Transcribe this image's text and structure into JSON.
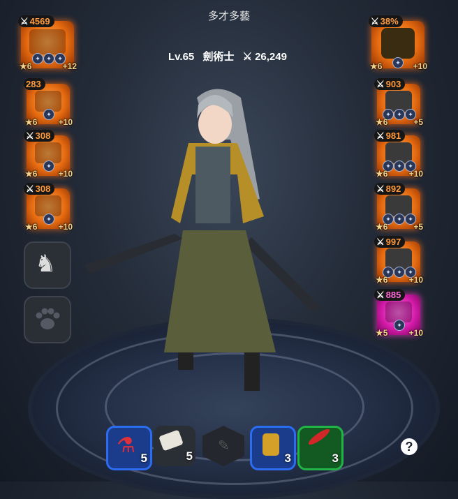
{
  "header": {
    "title": "多才多藝"
  },
  "character": {
    "level": "Lv.65",
    "class": "劍術士",
    "power": "26,249"
  },
  "left_slots": [
    {
      "power": "4569",
      "stars": "★6",
      "enhance": "+12"
    },
    {
      "power": "283",
      "stars": "★6",
      "enhance": "+10"
    },
    {
      "power": "308",
      "stars": "★6",
      "enhance": "+10"
    },
    {
      "power": "308",
      "stars": "★6",
      "enhance": "+10"
    }
  ],
  "right_slots": [
    {
      "power": "38%",
      "stars": "★6",
      "enhance": "+10"
    },
    {
      "power": "903",
      "stars": "★6",
      "enhance": "+5"
    },
    {
      "power": "981",
      "stars": "★6",
      "enhance": "+10"
    },
    {
      "power": "892",
      "stars": "★6",
      "enhance": "+5"
    },
    {
      "power": "997",
      "stars": "★6",
      "enhance": "+10"
    },
    {
      "power": "885",
      "stars": "★5",
      "enhance": "+10"
    }
  ],
  "consumables": [
    {
      "name": "potion",
      "count": "5"
    },
    {
      "name": "scroll",
      "count": "5"
    },
    {
      "name": "empty-slot",
      "count": ""
    },
    {
      "name": "lantern",
      "count": "3"
    },
    {
      "name": "feather",
      "count": "3"
    }
  ],
  "icons": {
    "mount": "horse-icon",
    "pet": "paw-icon",
    "help": "?"
  },
  "colors": {
    "orange_glow": "#e56a10",
    "pink_glow": "#d41aa8",
    "blue_frame": "#1f5ed8",
    "green_frame": "#1e9a3a"
  }
}
